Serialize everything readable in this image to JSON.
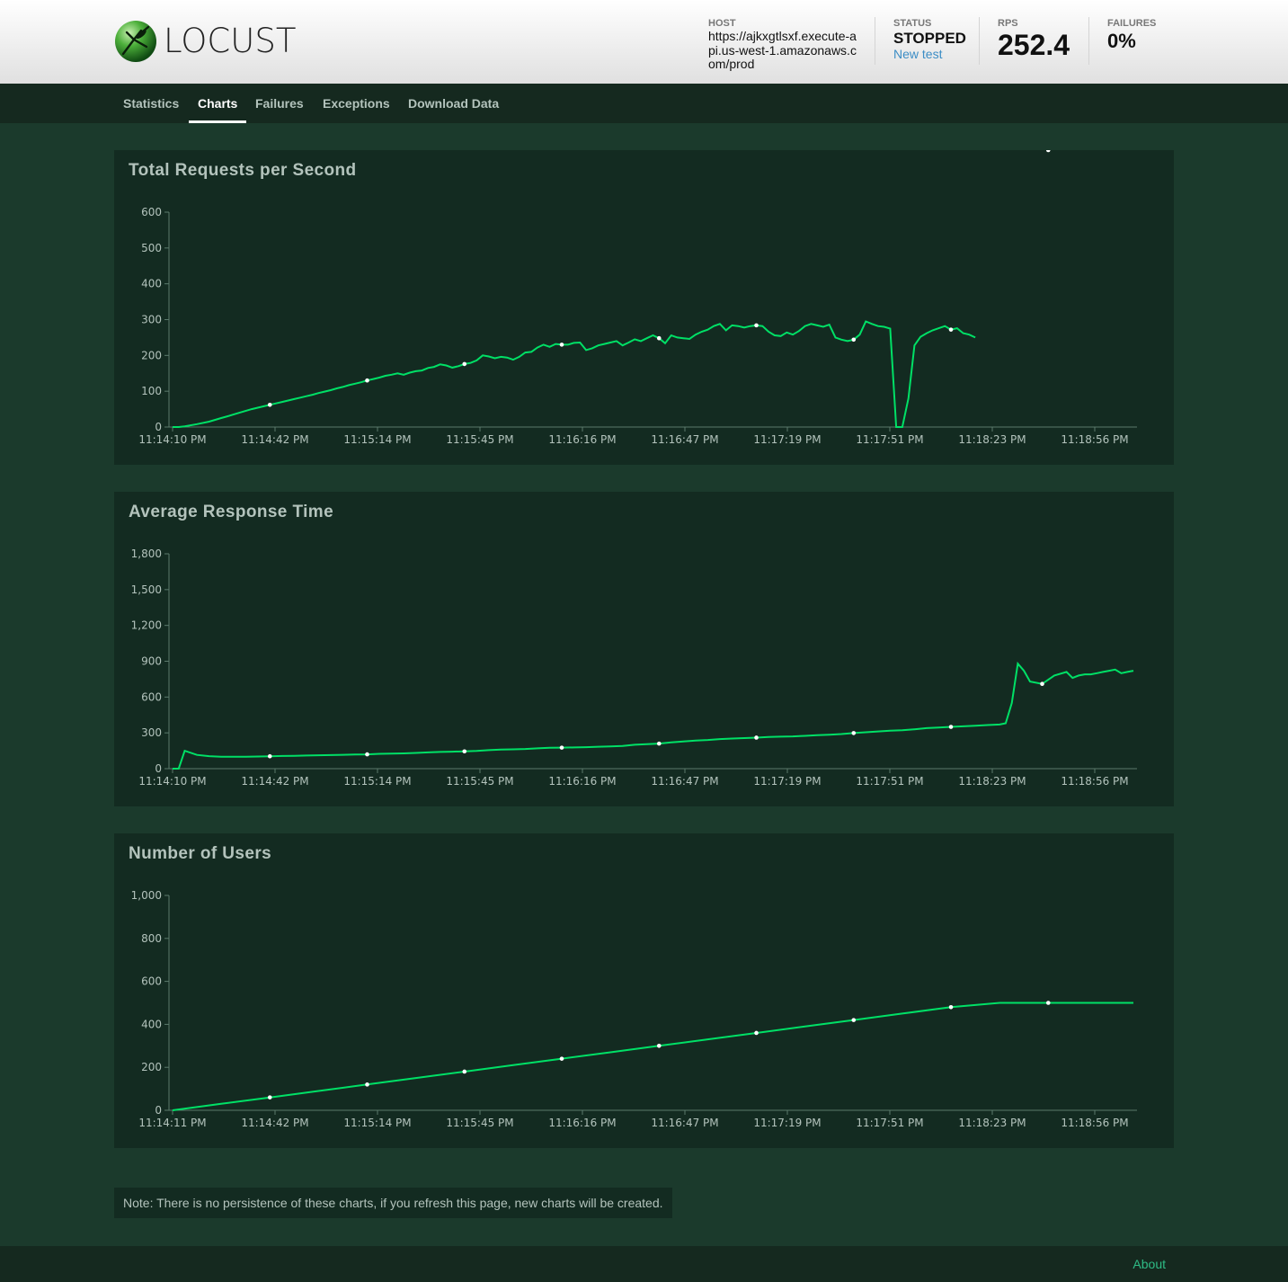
{
  "header": {
    "logo_text": "LOCUST",
    "host_label": "HOST",
    "host_value": "https://ajkxgtlsxf.execute-api.us-west-1.amazonaws.com/prod",
    "status_label": "STATUS",
    "status_value": "STOPPED",
    "new_test_link": "New test",
    "rps_label": "RPS",
    "rps_value": "252.4",
    "failures_label": "FAILURES",
    "failures_value": "0%"
  },
  "tabs": [
    {
      "label": "Statistics",
      "active": false
    },
    {
      "label": "Charts",
      "active": true
    },
    {
      "label": "Failures",
      "active": false
    },
    {
      "label": "Exceptions",
      "active": false
    },
    {
      "label": "Download Data",
      "active": false
    }
  ],
  "note": "Note: There is no persistence of these charts, if you refresh this page, new charts will be created.",
  "footer": {
    "about": "About"
  },
  "colors": {
    "line": "#00e066",
    "axis": "#5b7a6c",
    "text": "#b3c3bc"
  },
  "chart_data": [
    {
      "type": "line",
      "title": "Total Requests per Second",
      "yticks": [
        "0",
        "100",
        "200",
        "300",
        "400",
        "500",
        "600"
      ],
      "ylim": [
        0,
        600
      ],
      "xticks": [
        "11:14:10 PM",
        "11:14:42 PM",
        "11:15:14 PM",
        "11:15:45 PM",
        "11:16:16 PM",
        "11:16:47 PM",
        "11:17:19 PM",
        "11:17:51 PM",
        "11:18:23 PM",
        "11:18:56 PM"
      ],
      "x": [
        0,
        2,
        4,
        8,
        12,
        14,
        16,
        18,
        20,
        22,
        24,
        26,
        28,
        30,
        32,
        34,
        36,
        38,
        40,
        42,
        44,
        46,
        48,
        50,
        52,
        54,
        56,
        58,
        60,
        62,
        64,
        66,
        68,
        70,
        72,
        74,
        76,
        78,
        80,
        82,
        84,
        86,
        88,
        90,
        92,
        94,
        96,
        98,
        100,
        102,
        104,
        106,
        108,
        110,
        112,
        114,
        116,
        118,
        120,
        122,
        124,
        126,
        128,
        130,
        132,
        134,
        136,
        138,
        140,
        142,
        144,
        146,
        148,
        150,
        152,
        154,
        156,
        158,
        160,
        162,
        164,
        166,
        168,
        170,
        172,
        174,
        176,
        178,
        180,
        182,
        184,
        186,
        188,
        190,
        192,
        194,
        196,
        198,
        200,
        202,
        204,
        206,
        208,
        210,
        212,
        214,
        216,
        218,
        220,
        222,
        224,
        226,
        228,
        230,
        232,
        234,
        236,
        238,
        240,
        242,
        244,
        246,
        248,
        250,
        252,
        254,
        256,
        258,
        260,
        262,
        264,
        266,
        268,
        270,
        272,
        274,
        276,
        278,
        280,
        282,
        284,
        286,
        288,
        290,
        292,
        294,
        296,
        298,
        300,
        302,
        304,
        306,
        308,
        310,
        312,
        314,
        316
      ],
      "values": [
        0,
        0,
        2,
        8,
        15,
        20,
        25,
        30,
        35,
        40,
        45,
        50,
        54,
        58,
        62,
        66,
        70,
        74,
        78,
        82,
        86,
        90,
        95,
        99,
        103,
        108,
        112,
        117,
        121,
        125,
        130,
        134,
        138,
        143,
        146,
        150,
        146,
        152,
        156,
        158,
        165,
        168,
        175,
        172,
        166,
        170,
        176,
        179,
        186,
        200,
        197,
        192,
        196,
        194,
        188,
        196,
        208,
        210,
        222,
        230,
        224,
        232,
        230,
        230,
        235,
        236,
        215,
        220,
        228,
        232,
        236,
        240,
        228,
        236,
        245,
        240,
        248,
        256,
        248,
        234,
        256,
        250,
        248,
        246,
        258,
        266,
        272,
        282,
        288,
        270,
        284,
        282,
        278,
        282,
        284,
        282,
        266,
        256,
        254,
        264,
        258,
        268,
        282,
        288,
        284,
        280,
        286,
        250,
        244,
        240,
        244,
        258,
        295,
        288,
        282,
        280,
        275,
        0,
        0,
        80,
        228,
        252,
        262,
        270,
        276,
        282,
        272,
        276,
        262,
        258,
        250
      ]
    },
    {
      "type": "line",
      "title": "Average Response Time",
      "yticks": [
        "0",
        "300",
        "600",
        "900",
        "1,200",
        "1,500",
        "1,800"
      ],
      "ylim": [
        0,
        1800
      ],
      "xticks": [
        "11:14:10 PM",
        "11:14:42 PM",
        "11:15:14 PM",
        "11:15:45 PM",
        "11:16:16 PM",
        "11:16:47 PM",
        "11:17:19 PM",
        "11:17:51 PM",
        "11:18:23 PM",
        "11:18:56 PM"
      ],
      "x": [
        0,
        2,
        4,
        8,
        12,
        16,
        20,
        24,
        28,
        32,
        36,
        40,
        44,
        48,
        52,
        56,
        60,
        64,
        68,
        72,
        76,
        80,
        84,
        88,
        92,
        96,
        100,
        104,
        108,
        112,
        116,
        120,
        124,
        128,
        132,
        136,
        140,
        144,
        148,
        152,
        156,
        160,
        164,
        168,
        172,
        176,
        180,
        184,
        188,
        192,
        196,
        200,
        204,
        208,
        212,
        216,
        220,
        224,
        228,
        232,
        236,
        240,
        244,
        248,
        252,
        256,
        260,
        264,
        268,
        272,
        274,
        276,
        278,
        280,
        282,
        286,
        290,
        294,
        296,
        298,
        300,
        302,
        304,
        306,
        308,
        310,
        312,
        314,
        316
      ],
      "values": [
        0,
        0,
        150,
        115,
        105,
        100,
        100,
        100,
        102,
        104,
        106,
        108,
        110,
        112,
        114,
        116,
        118,
        120,
        124,
        126,
        128,
        132,
        136,
        140,
        142,
        145,
        148,
        155,
        160,
        162,
        165,
        170,
        175,
        176,
        178,
        180,
        184,
        186,
        190,
        200,
        205,
        210,
        220,
        228,
        235,
        240,
        248,
        252,
        256,
        260,
        265,
        268,
        270,
        275,
        280,
        285,
        290,
        298,
        305,
        312,
        318,
        322,
        330,
        340,
        345,
        350,
        355,
        360,
        365,
        370,
        380,
        550,
        880,
        820,
        730,
        710,
        780,
        810,
        760,
        780,
        790,
        790,
        800,
        810,
        820,
        830,
        800,
        810,
        820
      ]
    },
    {
      "type": "line",
      "title": "Number of Users",
      "yticks": [
        "0",
        "200",
        "400",
        "600",
        "800",
        "1,000"
      ],
      "ylim": [
        0,
        1000
      ],
      "xticks": [
        "11:14:11 PM",
        "11:14:42 PM",
        "11:15:14 PM",
        "11:15:45 PM",
        "11:16:16 PM",
        "11:16:47 PM",
        "11:17:19 PM",
        "11:17:51 PM",
        "11:18:23 PM",
        "11:18:56 PM"
      ],
      "x": [
        0,
        16,
        32,
        48,
        64,
        80,
        96,
        112,
        128,
        144,
        160,
        176,
        192,
        208,
        224,
        240,
        256,
        272,
        288,
        304,
        316
      ],
      "values": [
        0,
        30,
        60,
        90,
        120,
        150,
        180,
        210,
        240,
        270,
        300,
        330,
        360,
        390,
        420,
        450,
        480,
        500,
        500,
        500,
        500
      ]
    }
  ]
}
